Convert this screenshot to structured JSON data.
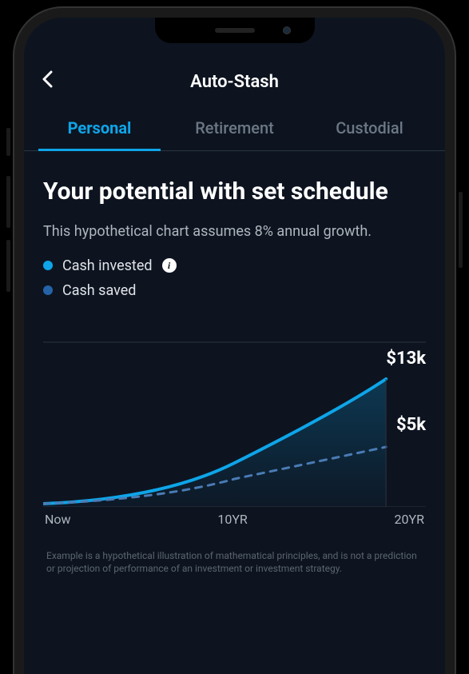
{
  "header": {
    "title": "Auto-Stash"
  },
  "tabs": {
    "items": [
      {
        "label": "Personal",
        "active": true
      },
      {
        "label": "Retirement",
        "active": false
      },
      {
        "label": "Custodial",
        "active": false
      }
    ]
  },
  "content": {
    "heading": "Your potential with set schedule",
    "subtext": "This hypothetical chart assumes 8% annual growth.",
    "legend": {
      "invested": "Cash invested",
      "saved": "Cash saved"
    },
    "disclaimer": "Example is a hypothetical illustration of mathematical principles, and is not a prediction or projection of performance of an investment or investment strategy."
  },
  "chart_data": {
    "type": "area",
    "x": [
      0,
      10,
      20
    ],
    "x_labels": [
      "Now",
      "10YR",
      "20YR"
    ],
    "series": [
      {
        "name": "Cash invested",
        "values": [
          0.3,
          4.0,
          13
        ],
        "color": "#0ea5e9",
        "style": "solid-fill"
      },
      {
        "name": "Cash saved",
        "values": [
          0.3,
          2.5,
          5
        ],
        "color": "#2563a8",
        "style": "dashed"
      }
    ],
    "end_labels": {
      "invested": "$13k",
      "saved": "$5k"
    },
    "ylim": [
      0,
      16
    ],
    "ylabel": "",
    "xlabel": ""
  }
}
